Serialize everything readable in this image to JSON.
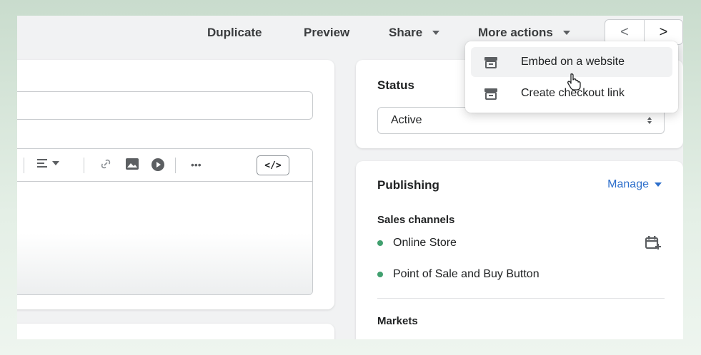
{
  "topbar": {
    "duplicate": "Duplicate",
    "preview": "Preview",
    "share": "Share",
    "more_actions": "More actions",
    "prev": "<",
    "next": ">"
  },
  "dropdown": {
    "items": [
      {
        "label": "Embed on a website",
        "icon": "embed-icon"
      },
      {
        "label": "Create checkout link",
        "icon": "checkout-link-icon"
      }
    ]
  },
  "editor": {
    "code_button": "</>",
    "more": "•••"
  },
  "status": {
    "title": "Status",
    "value": "Active"
  },
  "publishing": {
    "title": "Publishing",
    "manage": "Manage",
    "sales_channels": "Sales channels",
    "channels": [
      {
        "label": "Online Store"
      },
      {
        "label": "Point of Sale and Buy Button"
      }
    ],
    "markets": "Markets"
  },
  "colors": {
    "accent": "#2c6ecb",
    "active_dot": "#41a06f"
  }
}
